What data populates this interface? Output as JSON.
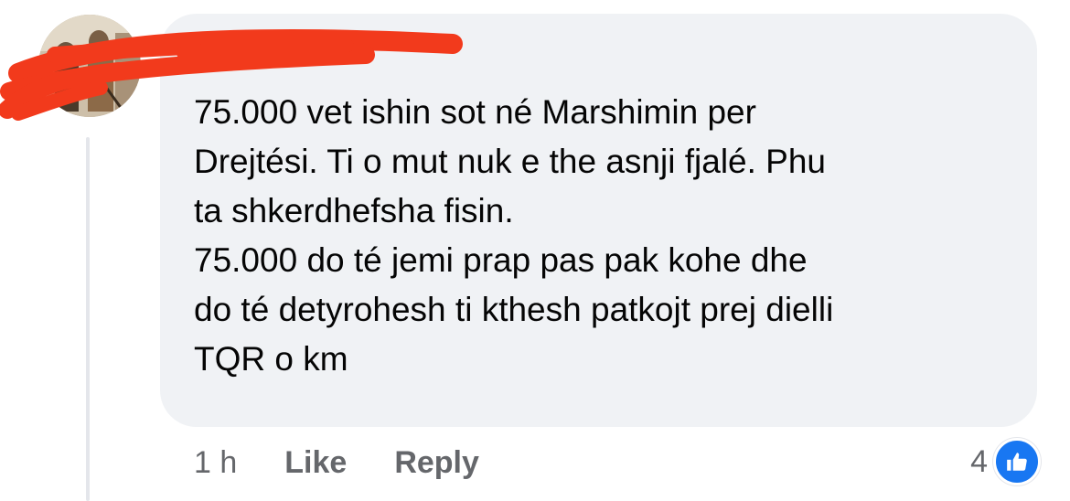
{
  "comment": {
    "author_name": "",
    "text": "75.000 vet ishin sot né Marshimin per\nDrejtési. Ti o mut nuk e the asnji fjalé. Phu\nta shkerdhefsha fisin.\n75.000 do té jemi prap pas pak kohe dhe\ndo té detyrohesh ti kthesh patkojt prej dielli\nTQR o km",
    "timestamp": "1 h",
    "like_label": "Like",
    "reply_label": "Reply",
    "reaction_count": "4"
  },
  "icons": {
    "avatar": "user-avatar-photo",
    "reaction": "thumbs-up-icon"
  },
  "colors": {
    "bubble": "#f0f2f5",
    "text": "#050505",
    "secondary_text": "#65676b",
    "like_blue": "#1877f2",
    "redaction": "#f23a1c"
  }
}
